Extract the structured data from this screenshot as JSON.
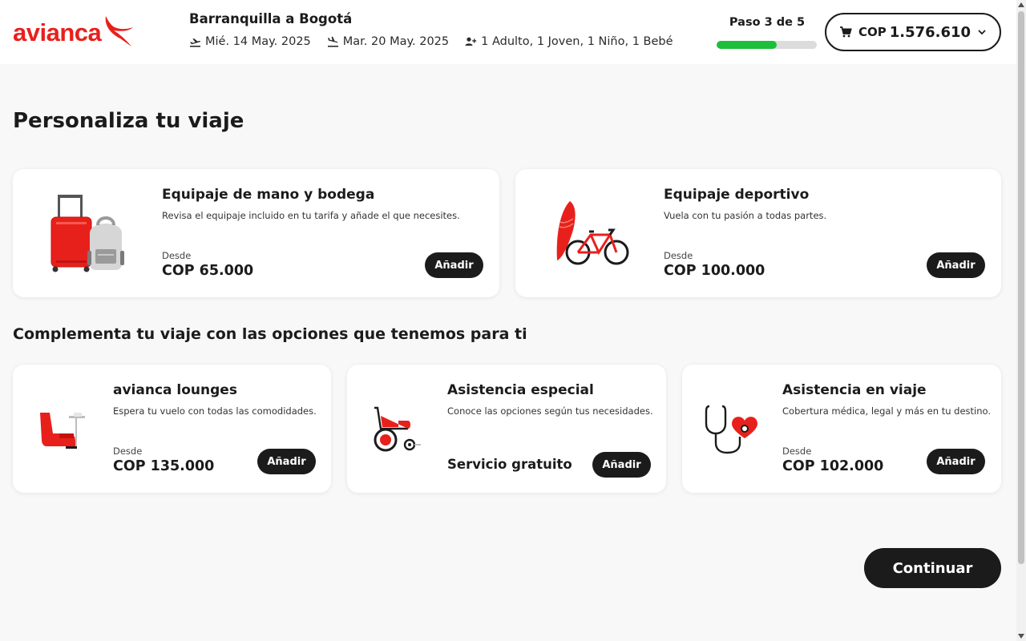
{
  "header": {
    "logo_text": "avianca",
    "route": "Barranquilla a Bogotá",
    "departure_date": "Mié. 14 May. 2025",
    "return_date": "Mar. 20 May. 2025",
    "passengers": "1 Adulto, 1 Joven, 1 Niño, 1 Bebé",
    "step_text": "Paso 3 de 5",
    "step_progress": 0.6,
    "cart_currency": "COP",
    "cart_total": "1.576.610"
  },
  "main": {
    "page_title": "Personaliza tu viaje",
    "section_title": "Complementa tu viaje con las opciones que tenemos para ti",
    "continue_label": "Continuar"
  },
  "cards": {
    "luggage": {
      "title": "Equipaje de mano y bodega",
      "description": "Revisa el equipaje incluido en tu tarifa y añade el que necesites.",
      "from_label": "Desde",
      "price": "COP 65.000",
      "button": "Añadir"
    },
    "sports": {
      "title": "Equipaje deportivo",
      "description": "Vuela con tu pasión a todas partes.",
      "from_label": "Desde",
      "price": "COP 100.000",
      "button": "Añadir"
    },
    "lounges": {
      "title": "avianca lounges",
      "description": "Espera tu vuelo con todas las comodidades.",
      "from_label": "Desde",
      "price": "COP 135.000",
      "button": "Añadir"
    },
    "special": {
      "title": "Asistencia especial",
      "description": "Conoce las opciones según tus necesidades.",
      "price_text": "Servicio gratuito",
      "button": "Añadir"
    },
    "travel": {
      "title": "Asistencia en viaje",
      "description": "Cobertura médica, legal y más en tu destino.",
      "from_label": "Desde",
      "price": "COP 102.000",
      "button": "Añadir"
    }
  },
  "colors": {
    "brand_red": "#e8201c",
    "progress_green": "#1bbf3a",
    "button_dark": "#1b1b1b"
  },
  "icons": [
    "avianca-bird-logo",
    "departure-plane-icon",
    "arrival-plane-icon",
    "passengers-icon",
    "cart-icon",
    "chevron-down-icon"
  ]
}
